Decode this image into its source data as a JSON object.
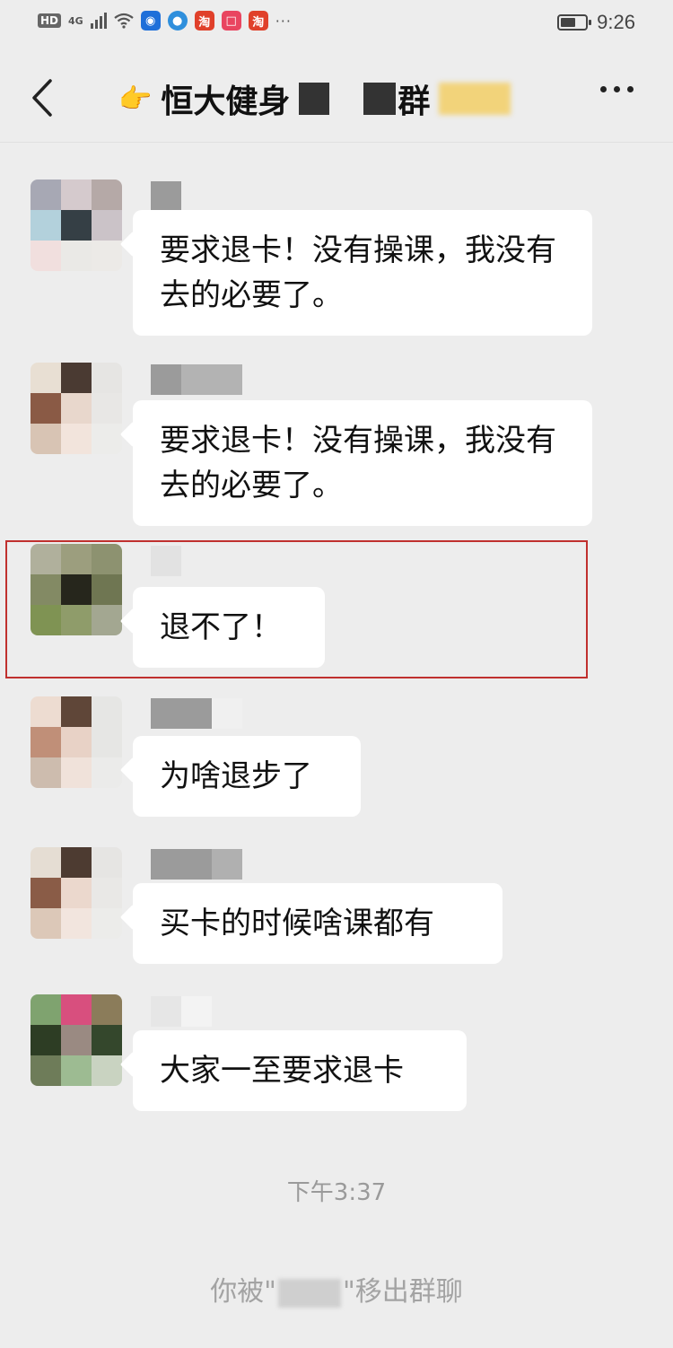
{
  "status_bar": {
    "network_badge": "HD",
    "network_type": "4G",
    "app_icon_label": "淘",
    "time": "9:26",
    "battery_level": 0.6,
    "more_dots": "···"
  },
  "header": {
    "title_visible": "恒大健身",
    "hand_emoji": "👉",
    "title_suffix_char": "群"
  },
  "messages": [
    {
      "text": "要求退卡！没有操课，我没有去的必要了。"
    },
    {
      "text": "要求退卡！没有操课，我没有去的必要了。"
    },
    {
      "text": "退不了！"
    },
    {
      "text": "为啥退步了"
    },
    {
      "text": "买卡的时候啥课都有"
    },
    {
      "text": "大家一至要求退卡"
    }
  ],
  "timestamp": "下午3:37",
  "system_notice": {
    "prefix": "你被\"",
    "suffix": "\"移出群聊"
  },
  "colors": {
    "background": "#ededed",
    "bubble": "#ffffff",
    "highlight_box": "#c0302e"
  }
}
